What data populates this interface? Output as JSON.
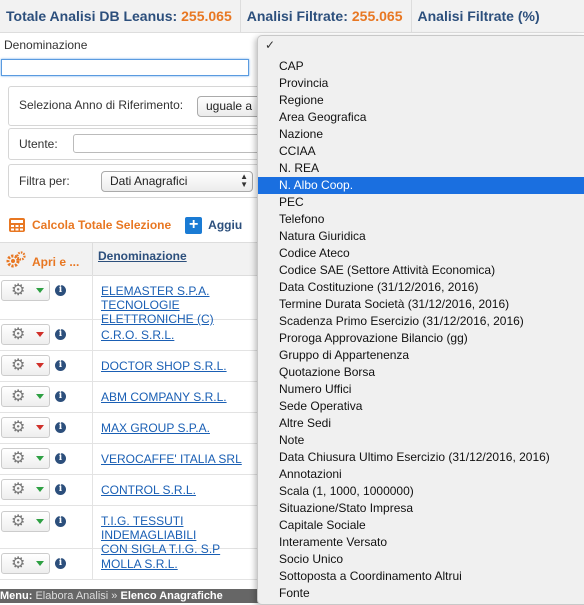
{
  "header": {
    "total_label": "Totale Analisi DB Leanus:",
    "total_value": "255.065",
    "filtered_label": "Analisi Filtrate:",
    "filtered_value": "255.065",
    "filtered_pct_label": "Analisi Filtrate (%)"
  },
  "filters": {
    "denominazione_label": "Denominazione",
    "denominazione_value": "",
    "anno_label": "Seleziona Anno di Riferimento:",
    "anno_value": "uguale a",
    "utente_label": "Utente:",
    "utente_value": "",
    "filtra_label": "Filtra per:",
    "filtra_value": "Dati Anagrafici"
  },
  "actions": {
    "calc_label": "Calcola Totale Selezione",
    "add_label": "Aggiu"
  },
  "table": {
    "col_actions": "Apri e ...",
    "col_denominazione": "Denominazione",
    "rows": [
      {
        "name_line1": "ELEMASTER S.P.A. TECNOLOGIE",
        "name_line2": "ELETTRONICHE (C)",
        "caret": "green"
      },
      {
        "name_line1": "C.R.O. S.R.L.",
        "name_line2": "",
        "caret": "red"
      },
      {
        "name_line1": "DOCTOR SHOP S.R.L.",
        "name_line2": "",
        "caret": "red"
      },
      {
        "name_line1": "ABM COMPANY S.R.L.",
        "name_line2": "",
        "caret": "green"
      },
      {
        "name_line1": "MAX GROUP S.P.A.",
        "name_line2": "",
        "caret": "red"
      },
      {
        "name_line1": "VEROCAFFE' ITALIA SRL",
        "name_line2": "",
        "caret": "green"
      },
      {
        "name_line1": "CONTROL S.R.L.",
        "name_line2": "",
        "caret": "green"
      },
      {
        "name_line1": "T.I.G. TESSUTI INDEMAGLIABILI",
        "name_line2": "CON SIGLA T.I.G. S.P",
        "caret": "green"
      },
      {
        "name_line1": "MOLLA S.R.L.",
        "name_line2": "",
        "caret": "green"
      }
    ]
  },
  "footer": {
    "menu_label": "Menu:",
    "path": "Elabora Analisi",
    "separator": "»",
    "current": "Elenco Anagrafiche"
  },
  "dropdown": {
    "checkmark": "✓",
    "selected_index": 7,
    "options": [
      "CAP",
      "Provincia",
      "Regione",
      "Area Geografica",
      "Nazione",
      "CCIAA",
      "N. REA",
      "N. Albo Coop.",
      "PEC",
      "Telefono",
      "Natura Giuridica",
      "Codice Ateco",
      "Codice SAE (Settore Attività Economica)",
      "Data Costituzione (31/12/2016, 2016)",
      "Termine Durata Società (31/12/2016, 2016)",
      "Scadenza Primo Esercizio (31/12/2016, 2016)",
      "Proroga Approvazione Bilancio (gg)",
      "Gruppo di Appartenenza",
      "Quotazione Borsa",
      "Numero Uffici",
      "Sede Operativa",
      "Altre Sedi",
      "Note",
      "Data Chiusura Ultimo Esercizio (31/12/2016, 2016)",
      "Annotazioni",
      "Scala (1, 1000, 1000000)",
      "Situazione/Stato Impresa",
      "Capitale Sociale",
      "Interamente Versato",
      "Socio Unico",
      "Sottoposta a Coordinamento Altrui",
      "Fonte"
    ]
  },
  "colors": {
    "accent_orange": "#e87722",
    "brand_blue": "#2c4f7c",
    "link_blue": "#1a5fb4",
    "selection_blue": "#1a6fe0"
  }
}
